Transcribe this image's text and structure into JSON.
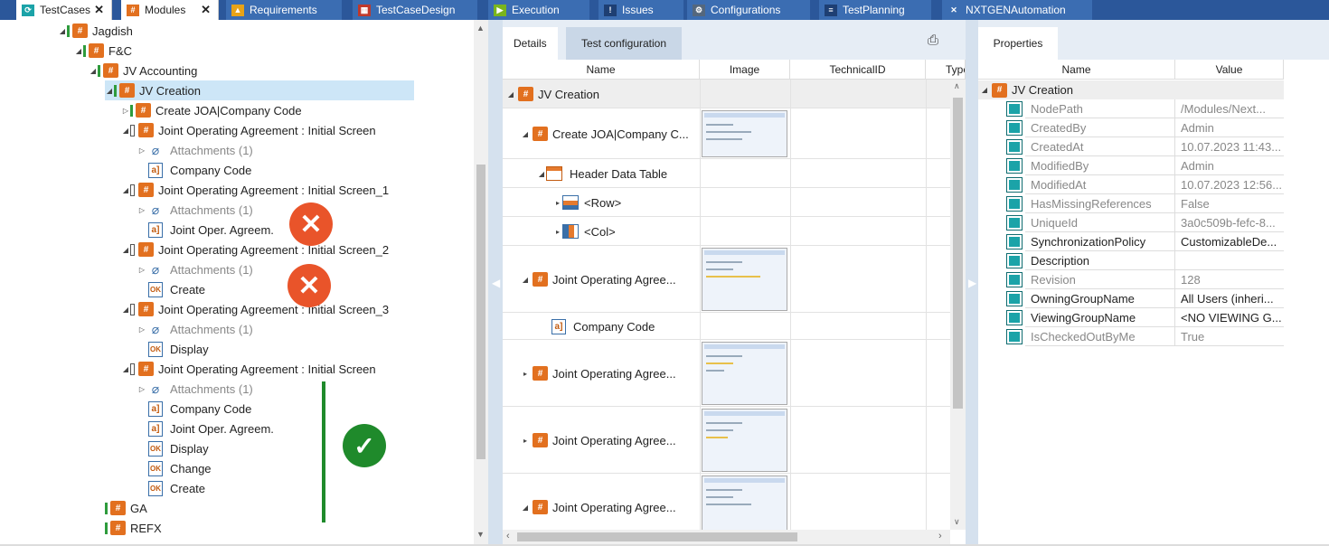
{
  "tabs": [
    {
      "label": "TestCases",
      "icon": "refresh-icon",
      "active": true
    },
    {
      "label": "Modules",
      "icon": "module-icon",
      "active": true
    },
    {
      "label": "Requirements",
      "icon": "warning-icon"
    },
    {
      "label": "TestCaseDesign",
      "icon": "table-icon"
    },
    {
      "label": "Execution",
      "icon": "play-icon"
    },
    {
      "label": "Issues",
      "icon": "issue-icon"
    },
    {
      "label": "Configurations",
      "icon": "config-icon"
    },
    {
      "label": "TestPlanning",
      "icon": "plan-icon"
    },
    {
      "label": "NXTGENAutomation",
      "icon": "cross-icon"
    }
  ],
  "tree": [
    {
      "label": "Jagdish"
    },
    {
      "label": "F&C"
    },
    {
      "label": "JV Accounting"
    },
    {
      "label": "JV Creation"
    },
    {
      "label": "Create JOA|Company Code"
    },
    {
      "label": "Joint Operating Agreement : Initial Screen"
    },
    {
      "label": "Attachments (1)"
    },
    {
      "label": "Company Code"
    },
    {
      "label": "Joint Operating Agreement : Initial Screen_1"
    },
    {
      "label": "Attachments (1)"
    },
    {
      "label": "Joint Oper. Agreem."
    },
    {
      "label": "Joint Operating Agreement : Initial Screen_2"
    },
    {
      "label": "Attachments (1)"
    },
    {
      "label": "Create"
    },
    {
      "label": "Joint Operating Agreement : Initial Screen_3"
    },
    {
      "label": "Attachments (1)"
    },
    {
      "label": "Display"
    },
    {
      "label": "Joint Operating Agreement : Initial Screen"
    },
    {
      "label": "Attachments (1)"
    },
    {
      "label": "Company Code"
    },
    {
      "label": "Joint Oper. Agreem."
    },
    {
      "label": "Display"
    },
    {
      "label": "Change"
    },
    {
      "label": "Create"
    },
    {
      "label": "GA"
    },
    {
      "label": "REFX"
    }
  ],
  "field_icon": "a]",
  "ok_icon": "OK",
  "mid": {
    "tabs": [
      "Details",
      "Test configuration"
    ],
    "columns": [
      "Name",
      "Image",
      "TechnicalID",
      "Type"
    ],
    "rows": [
      {
        "label": "JV Creation"
      },
      {
        "label": "Create JOA|Company C..."
      },
      {
        "label": "Header Data Table"
      },
      {
        "label": "<Row>"
      },
      {
        "label": "<Col>"
      },
      {
        "label": "Joint Operating Agree..."
      },
      {
        "label": "Company Code"
      },
      {
        "label": "Joint Operating Agree..."
      },
      {
        "label": "Joint Operating Agree..."
      },
      {
        "label": "Joint Operating Agree..."
      }
    ]
  },
  "props": {
    "tab": "Properties",
    "columns": [
      "Name",
      "Value"
    ],
    "root": "JV Creation",
    "rows": [
      {
        "name": "NodePath",
        "value": "/Modules/Next...",
        "grey": true
      },
      {
        "name": "CreatedBy",
        "value": "Admin",
        "grey": true
      },
      {
        "name": "CreatedAt",
        "value": "10.07.2023 11:43...",
        "grey": true
      },
      {
        "name": "ModifiedBy",
        "value": "Admin",
        "grey": true
      },
      {
        "name": "ModifiedAt",
        "value": "10.07.2023 12:56...",
        "grey": true
      },
      {
        "name": "HasMissingReferences",
        "value": "False",
        "grey": true
      },
      {
        "name": "UniqueId",
        "value": "3a0c509b-fefc-8...",
        "grey": true
      },
      {
        "name": "SynchronizationPolicy",
        "value": "CustomizableDe...",
        "grey": false
      },
      {
        "name": "Description",
        "value": "",
        "grey": false
      },
      {
        "name": "Revision",
        "value": "128",
        "grey": true
      },
      {
        "name": "OwningGroupName",
        "value": "All Users (inheri...",
        "grey": false
      },
      {
        "name": "ViewingGroupName",
        "value": "<NO VIEWING G...",
        "grey": false
      },
      {
        "name": "IsCheckedOutByMe",
        "value": "True",
        "grey": true
      }
    ]
  },
  "colors": {
    "accent": "#2b579a",
    "module": "#e2701f",
    "error": "#e9542a",
    "success": "#1f8a2b",
    "selected": "#cde6f7"
  }
}
